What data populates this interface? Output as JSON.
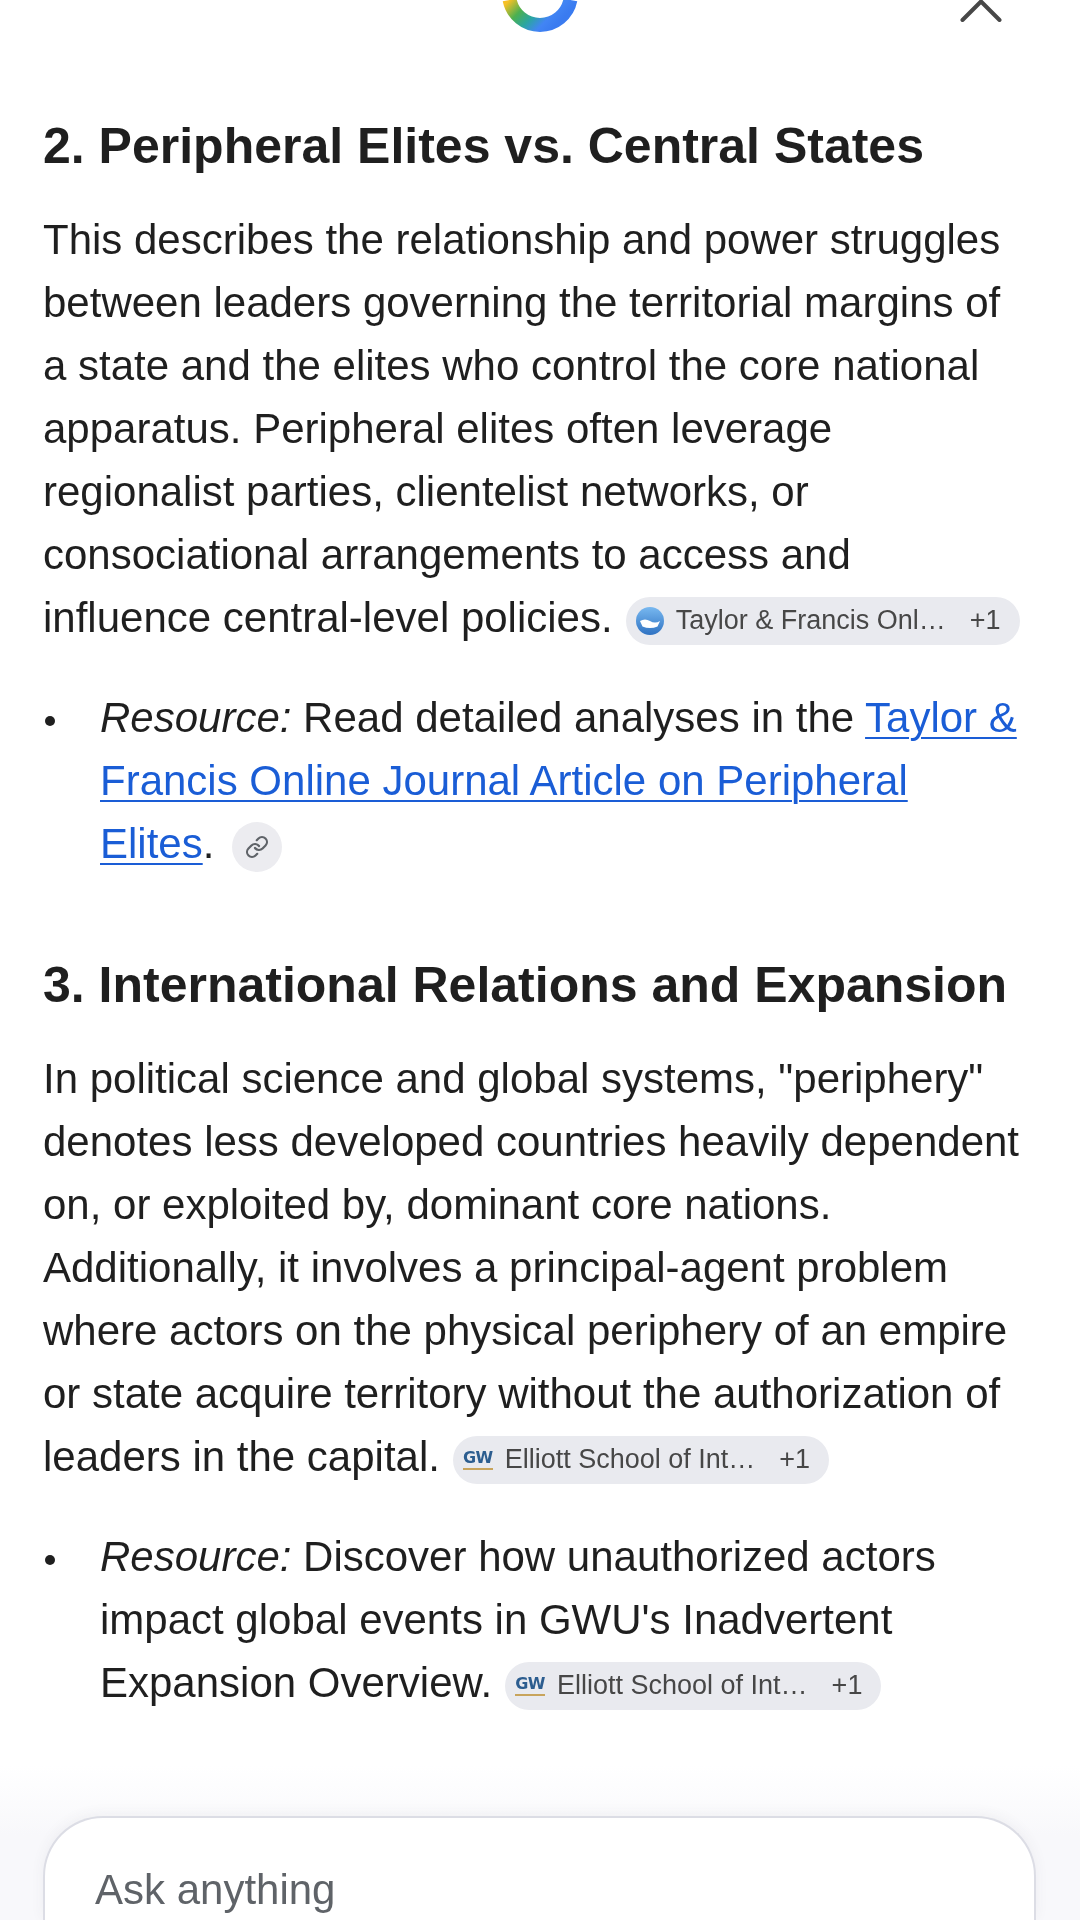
{
  "sections": [
    {
      "heading": "2. Peripheral Elites vs. Central States",
      "paragraph": {
        "text": "This describes the relationship and power struggles between leaders governing the territorial margins of a state and the elites who control the core national apparatus. Peripheral elites often leverage regionalist parties, clientelist networks, or consociational arrangements to access and influence central-level policies.",
        "trailing": {
          "kind": "source_chip",
          "logo": {
            "kind": "wave"
          },
          "source": "Taylor & Francis Onl…",
          "count": "+1"
        }
      },
      "bullets": [
        {
          "text": "*Resource:* Read detailed analyses in the",
          "link_lines": [
            "Taylor &",
            "Francis Online Journal Article on Peripheral",
            "Elites"
          ],
          "after": ".",
          "trailing": {
            "kind": "link_button"
          }
        }
      ]
    },
    {
      "heading": "3. International Relations and Expansion",
      "paragraph": {
        "text": "In political science and global systems, \"periphery\" denotes less developed countries heavily dependent on, or exploited by, dominant core nations. Additionally, it involves a principal-agent problem where actors on the physical periphery of an empire or state acquire territory without the authorization of leaders in the capital.",
        "trailing": {
          "kind": "source_chip",
          "logo": {
            "kind": "letters",
            "text": "GW"
          },
          "source": "Elliott School of Int…",
          "count": "+1"
        }
      },
      "bullets": [
        {
          "text": "*Resource:* Discover how unauthorized actors impact global events in GWU's Inadvertent Expansion Overview.",
          "trailing": {
            "kind": "source_chip",
            "logo": {
              "kind": "letters",
              "text": "GW"
            },
            "source": "Elliott School of Int…",
            "count": "+1"
          }
        }
      ]
    }
  ],
  "composer": {
    "placeholder": "Ask anything"
  }
}
